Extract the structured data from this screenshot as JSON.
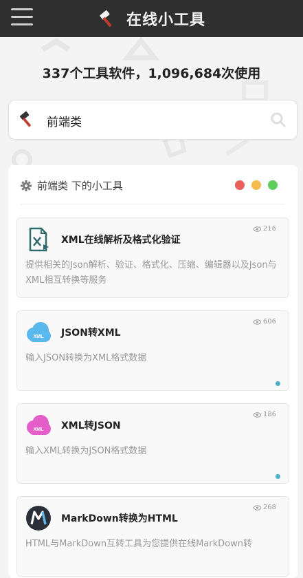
{
  "header": {
    "title": "在线小工具",
    "menu_icon": "hamburger-menu-icon",
    "logo_icon": "hammer-icon"
  },
  "stats": {
    "text": "337个工具软件，1,096,684次使用"
  },
  "search": {
    "value": "前端类",
    "tool_icon": "hammer-icon",
    "search_icon": "magnifier-icon"
  },
  "panel": {
    "title": "前端类 下的小工具",
    "icon": "gear-icon",
    "dots": [
      "#e9605a",
      "#f4bd4f",
      "#5fcd5b"
    ]
  },
  "tools": [
    {
      "title": "XML在线解析及格式化验证",
      "views": "216",
      "desc": "提供相关的Json解析、验证、格式化、压缩、编辑器以及Json与XML相互转换等服务",
      "icon": "xml-file-icon"
    },
    {
      "title": "JSON转XML",
      "views": "606",
      "desc": "输入JSON转换为XML格式数据",
      "icon": "xml-cloud-icon-blue",
      "icon_text": "XML"
    },
    {
      "title": "XML转JSON",
      "views": "186",
      "desc": "输入XML转换为JSON格式数据",
      "icon": "xml-cloud-icon-pink",
      "icon_text": "XML"
    },
    {
      "title": "MarkDown转换为HTML",
      "views": "268",
      "desc": "HTML与MarkDown互转工具为您提供在线MarkDown转",
      "icon": "markdown-m-icon"
    }
  ],
  "colors": {
    "topbar": "#2f2f2f",
    "accent_dot": "#4fb0cc",
    "xml_blue": "#5ab8ec",
    "xml_pink": "#e35ec9"
  }
}
